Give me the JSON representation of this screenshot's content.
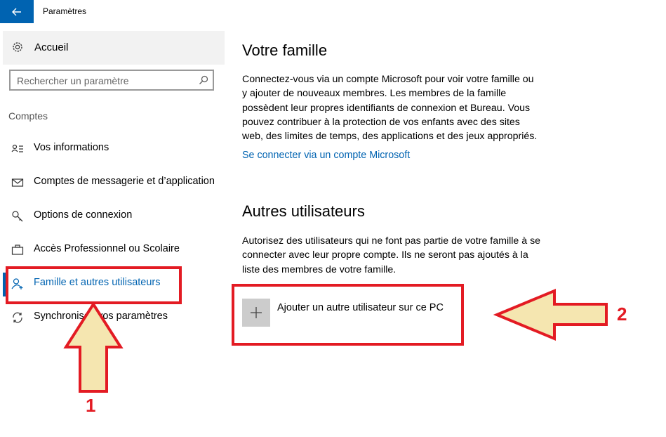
{
  "window": {
    "title": "Paramètres",
    "back_icon": "back-arrow-icon"
  },
  "sidebar": {
    "home": {
      "label": "Accueil",
      "icon": "gear-icon"
    },
    "search": {
      "placeholder": "Rechercher un paramètre",
      "icon": "search-icon"
    },
    "section": "Comptes",
    "items": [
      {
        "label": "Vos informations",
        "icon": "person-card-icon",
        "selected": false
      },
      {
        "label": "Comptes de messagerie et d’application",
        "icon": "mail-icon",
        "selected": false
      },
      {
        "label": "Options de connexion",
        "icon": "key-icon",
        "selected": false
      },
      {
        "label": "Accès Professionnel ou Scolaire",
        "icon": "briefcase-icon",
        "selected": false
      },
      {
        "label": "Famille et autres utilisateurs",
        "icon": "person-add-icon",
        "selected": true
      },
      {
        "label": "Synchronisez vos paramètres",
        "icon": "sync-icon",
        "selected": false
      }
    ]
  },
  "main": {
    "family": {
      "title": "Votre famille",
      "description": "Connectez-vous via un compte Microsoft pour voir votre famille ou\ny ajouter de nouveaux membres. Les membres de la famille\npossèdent leur propres identifiants de connexion et Bureau. Vous\npouvez contribuer à la protection de vos enfants avec des sites\nweb, des limites de temps, des applications et des jeux appropriés.",
      "link": "Se connecter via un compte Microsoft"
    },
    "others": {
      "title": "Autres utilisateurs",
      "description": "Autorisez des utilisateurs qui ne font pas partie de votre famille à se\nconnecter avec leur propre compte. Ils ne seront pas ajoutés à la\nliste des membres de votre famille.",
      "add_label": "Ajouter un autre utilisateur sur ce PC"
    }
  },
  "annotations": {
    "label_1": "1",
    "label_2": "2",
    "highlight_color": "#e31b23",
    "arrow_fill": "#f5e6b0"
  },
  "colors": {
    "accent": "#0063b1"
  }
}
